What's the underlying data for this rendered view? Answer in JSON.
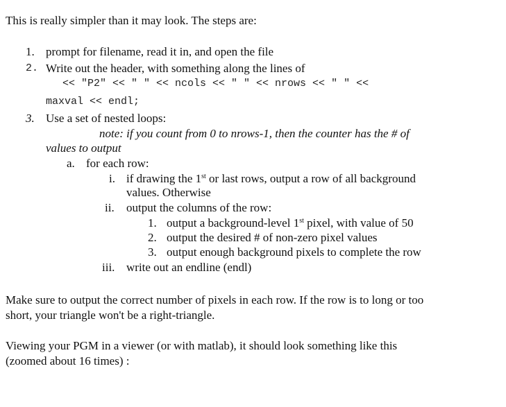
{
  "intro": "This is really simpler than it may look.  The steps are:",
  "steps": [
    {
      "marker": "1.",
      "text": "prompt for filename, read it in, and open the file"
    },
    {
      "marker": "2.",
      "text": "Write out the header, with something along the lines of",
      "code_line_1": "<< \"P2\" << \" \" << ncols << \" \" << nrows << \" \" <<",
      "code_line_2": "maxval << endl;"
    },
    {
      "marker": "3.",
      "text": "Use a set of nested loops:",
      "note_line_1": "note:  if you count from 0 to nrows-1, then the counter has the # of",
      "note_line_2": "values to output",
      "sub": {
        "marker": "a.",
        "text": "for each row:",
        "items": [
          {
            "marker": "i.",
            "text_before_sup": "if drawing the 1",
            "sup": "st",
            "text_after_sup": " or last rows, output a row of all background",
            "text_line_2": "values.  Otherwise"
          },
          {
            "marker": "ii.",
            "text": "output the columns of the row:",
            "items": [
              {
                "marker": "1.",
                "text_before_sup": "output a background-level 1",
                "sup": "st",
                "text_after_sup": " pixel, with value of 50"
              },
              {
                "marker": "2.",
                "text": "output the desired # of non-zero pixel values"
              },
              {
                "marker": "3.",
                "text": "output enough background pixels to complete the row"
              }
            ]
          },
          {
            "marker": "iii.",
            "text": "write out an endline (endl)"
          }
        ]
      }
    }
  ],
  "paragraph_1_line_1": "Make sure to output the correct number of pixels in each row.  If the row is to long or too",
  "paragraph_1_line_2": "short, your triangle won't be a right-triangle.",
  "paragraph_2_line_1": "Viewing your PGM in a viewer (or with matlab), it should look something like this",
  "paragraph_2_line_2": "(zoomed about 16 times) :"
}
